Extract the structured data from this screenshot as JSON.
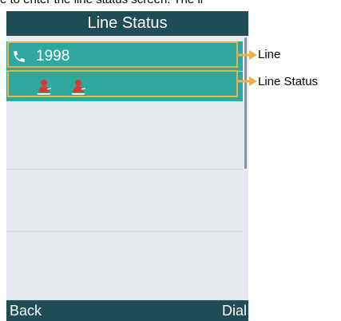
{
  "instruction_text": "e to enter the line status screen. The li",
  "screen": {
    "title": "Line Status",
    "line": {
      "number": "1998",
      "icon": "phone-handset-icon"
    },
    "line_status_icons": [
      "user-status-icon",
      "user-status-icon"
    ],
    "softkeys": {
      "left": "Back",
      "right": "Dial"
    }
  },
  "callouts": {
    "line_label": "Line",
    "status_label": "Line Status",
    "color": "#e7b24a"
  },
  "colors": {
    "title_bar": "#1f4c55",
    "highlight_row": "#2fa9a0",
    "screen_bg": "#e7ebef",
    "status_icon": "#d93b33"
  }
}
